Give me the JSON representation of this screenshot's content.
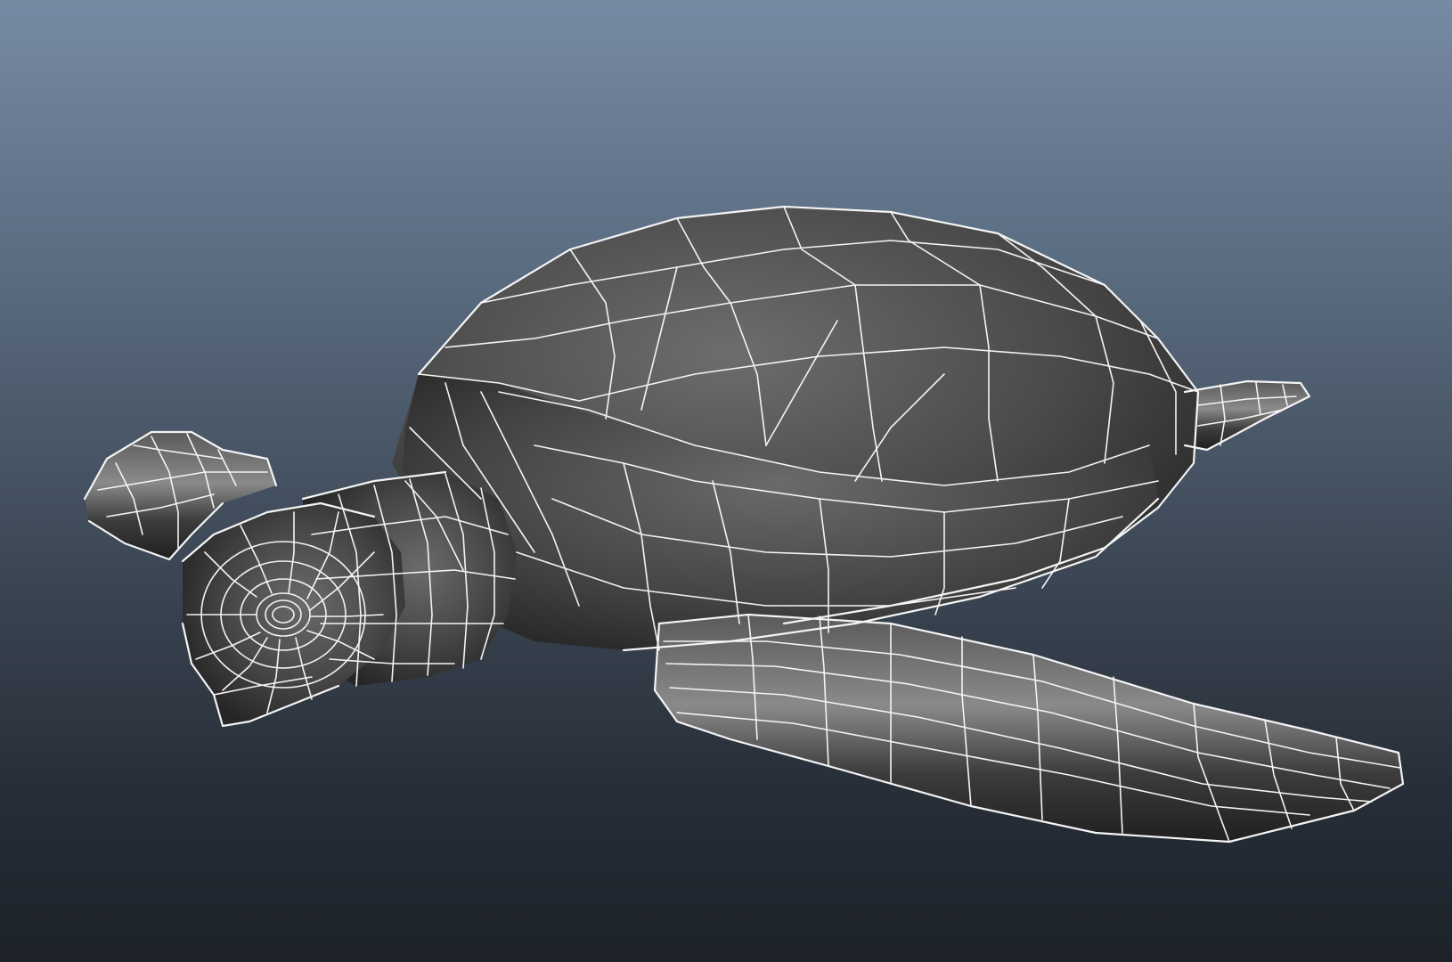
{
  "viewport": {
    "background_top": "#768aa3",
    "background_bottom": "#1d222a",
    "model_shade_light": "#7a7a7a",
    "model_shade_dark": "#202020",
    "wireframe_color": "#f4f4f4"
  },
  "model": {
    "subject": "sea-turtle",
    "display_mode": "smooth-shade-wireframe-on-shaded"
  }
}
